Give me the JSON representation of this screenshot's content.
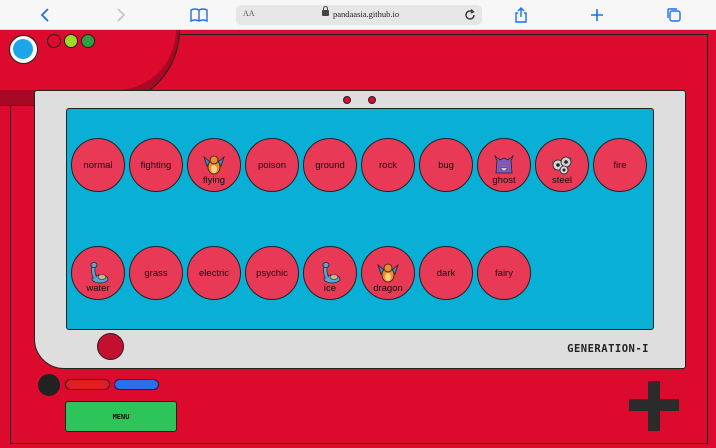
{
  "browser": {
    "reader_label": "AA",
    "url": "pandaasia.github.io",
    "icons": [
      "chevron-left-icon",
      "chevron-right-icon",
      "book-icon",
      "lock-icon",
      "reload-icon",
      "share-icon",
      "plus-icon",
      "tabs-icon"
    ]
  },
  "colors": {
    "body": "#dc0a2d",
    "screen": "#0aafd6",
    "type_button": "#e83a56",
    "lens": "#1ea4e8",
    "menu": "#2dc45a"
  },
  "indicator_lights": [
    "#dc0a2d",
    "#a0d92c",
    "#2ea043"
  ],
  "types_row1": [
    {
      "label": "normal",
      "sprite": ""
    },
    {
      "label": "fighting",
      "sprite": ""
    },
    {
      "label": "flying",
      "sprite": "charizard-sprite"
    },
    {
      "label": "poison",
      "sprite": ""
    },
    {
      "label": "ground",
      "sprite": ""
    },
    {
      "label": "rock",
      "sprite": ""
    },
    {
      "label": "bug",
      "sprite": ""
    },
    {
      "label": "ghost",
      "sprite": "gengar-sprite"
    },
    {
      "label": "steel",
      "sprite": "magnemite-sprite"
    },
    {
      "label": "fire",
      "sprite": ""
    }
  ],
  "types_row2": [
    {
      "label": "water",
      "sprite": "lapras-sprite"
    },
    {
      "label": "grass",
      "sprite": ""
    },
    {
      "label": "electric",
      "sprite": ""
    },
    {
      "label": "psychic",
      "sprite": ""
    },
    {
      "label": "ice",
      "sprite": "lapras-sprite"
    },
    {
      "label": "dragon",
      "sprite": "charizard-sprite"
    },
    {
      "label": "dark",
      "sprite": ""
    },
    {
      "label": "fairy",
      "sprite": ""
    }
  ],
  "generation_label": "GENERATION-I",
  "menu_label": "MENU"
}
